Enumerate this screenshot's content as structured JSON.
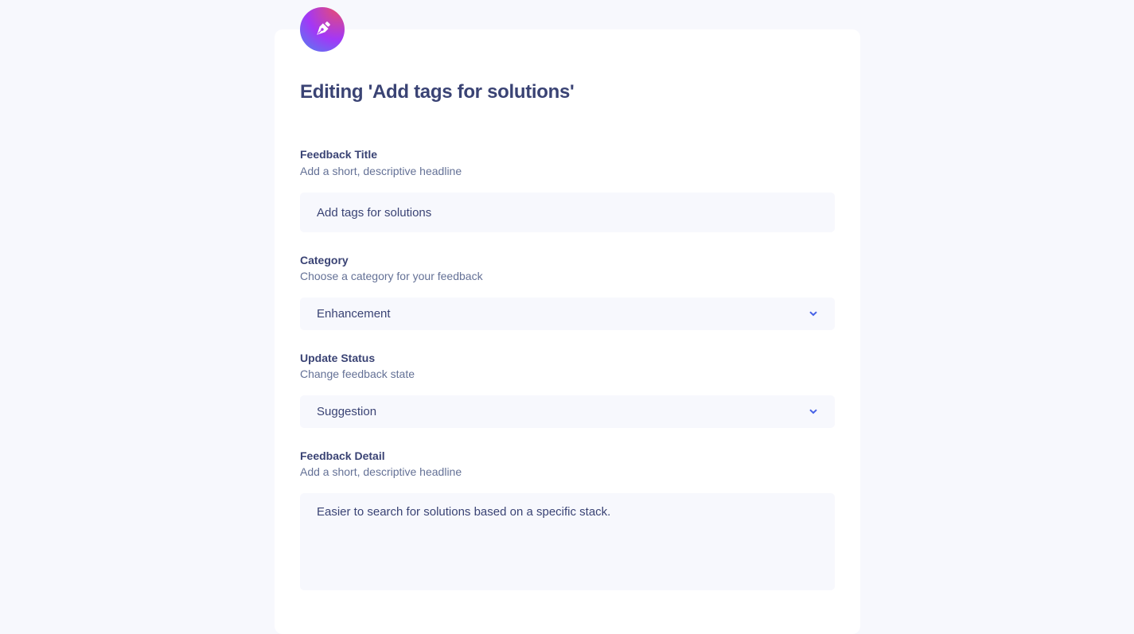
{
  "page": {
    "title": "Editing 'Add tags for solutions'"
  },
  "fields": {
    "title": {
      "label": "Feedback Title",
      "hint": "Add a short, descriptive headline",
      "value": "Add tags for solutions"
    },
    "category": {
      "label": "Category",
      "hint": "Choose a category for your feedback",
      "value": "Enhancement"
    },
    "status": {
      "label": "Update Status",
      "hint": "Change feedback state",
      "value": "Suggestion"
    },
    "detail": {
      "label": "Feedback Detail",
      "hint": "Add a short, descriptive headline",
      "value": "Easier to search for solutions based on a specific stack."
    }
  },
  "icons": {
    "badge": "pen-nib-icon",
    "select_chevron": "chevron-down-icon"
  },
  "colors": {
    "background": "#f7f8fd",
    "card": "#ffffff",
    "text_primary": "#3a4374",
    "text_secondary": "#647196",
    "accent": "#4661e6",
    "badge_gradient": [
      "#e84d70",
      "#a337f6",
      "#28a7ed"
    ]
  }
}
